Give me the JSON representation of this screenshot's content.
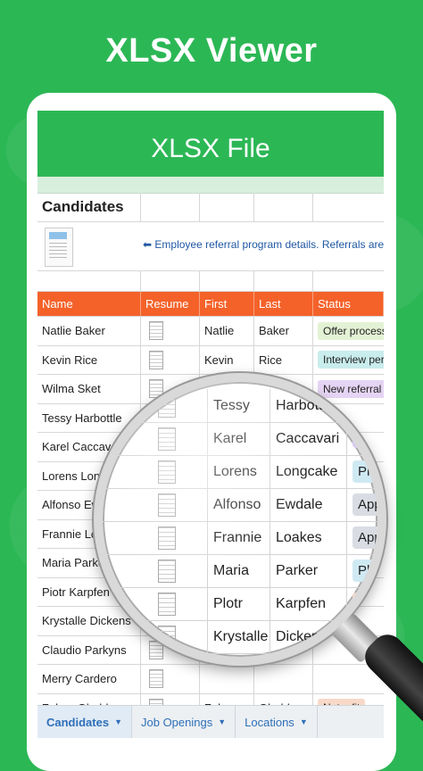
{
  "promo": {
    "title": "XLSX Viewer"
  },
  "app": {
    "header_title": "XLSX File"
  },
  "sheet": {
    "title": "Candidates",
    "banner": "Employee referral program details. Referrals are ou",
    "banner_arrow": "⬅",
    "columns": [
      "Name",
      "Resume",
      "First",
      "Last",
      "Status"
    ],
    "rows": [
      {
        "name": "Natlie Baker",
        "first": "Natlie",
        "last": "Baker",
        "status": "Offer process",
        "status_color": "#e3f2d4"
      },
      {
        "name": "Kevin Rice",
        "first": "Kevin",
        "last": "Rice",
        "status": "Interview per",
        "status_color": "#c9ecec"
      },
      {
        "name": "Wilma Sket",
        "first": "",
        "last": "",
        "status": "New referral",
        "status_color": "#e5d4f3"
      },
      {
        "name": "Tessy Harbottle",
        "first": "",
        "last": "",
        "status": "",
        "status_color": "#e3f2d4"
      },
      {
        "name": "Karel Caccavari",
        "first": "",
        "last": "",
        "status": "",
        "status_color": ""
      },
      {
        "name": "Lorens Longca",
        "first": "",
        "last": "",
        "status": "",
        "status_color": ""
      },
      {
        "name": "Alfonso Ewd",
        "first": "",
        "last": "",
        "status": "",
        "status_color": ""
      },
      {
        "name": "Frannie Lo",
        "first": "",
        "last": "",
        "status": "",
        "status_color": ""
      },
      {
        "name": "Maria Parke",
        "first": "",
        "last": "",
        "status": "",
        "status_color": ""
      },
      {
        "name": "Piotr Karpfen",
        "first": "",
        "last": "",
        "status": "",
        "status_color": ""
      },
      {
        "name": "Krystalle Dickens",
        "first": "",
        "last": "",
        "status": "",
        "status_color": ""
      },
      {
        "name": "Claudio Parkyns",
        "first": "",
        "last": "",
        "status": "",
        "status_color": ""
      },
      {
        "name": "Merry Cardero",
        "first": "",
        "last": "",
        "status": "",
        "status_color": ""
      },
      {
        "name": "Zelma Gladden",
        "first": "Zelma",
        "last": "Gladden",
        "status": "Not a fit",
        "status_color": "#f8d9c8"
      }
    ],
    "tabs": [
      {
        "label": "Candidates",
        "active": true
      },
      {
        "label": "Job Openings",
        "active": false
      },
      {
        "label": "Locations",
        "active": false
      }
    ]
  },
  "magnifier": {
    "rows": [
      {
        "first": "Tessy",
        "last": "Harbottl",
        "status": "",
        "status_color": ""
      },
      {
        "first": "Karel",
        "last": "Caccavari",
        "status": "",
        "status_color": "#d9ccf0"
      },
      {
        "first": "Lorens",
        "last": "Longcake",
        "status": "Pho",
        "status_color": "#cfe9f3"
      },
      {
        "first": "Alfonso",
        "last": "Ewdale",
        "status": "Appl",
        "status_color": "#d9dce3"
      },
      {
        "first": "Frannie",
        "last": "Loakes",
        "status": "Appl",
        "status_color": "#d9dce3"
      },
      {
        "first": "Maria",
        "last": "Parker",
        "status": "Pho",
        "status_color": "#cfe9f3"
      },
      {
        "first": "Plotr",
        "last": "Karpfen",
        "status": "N",
        "status_color": "#f8d9c8"
      },
      {
        "first": "Krystalle",
        "last": "Dickenson",
        "status": "",
        "status_color": ""
      }
    ]
  }
}
